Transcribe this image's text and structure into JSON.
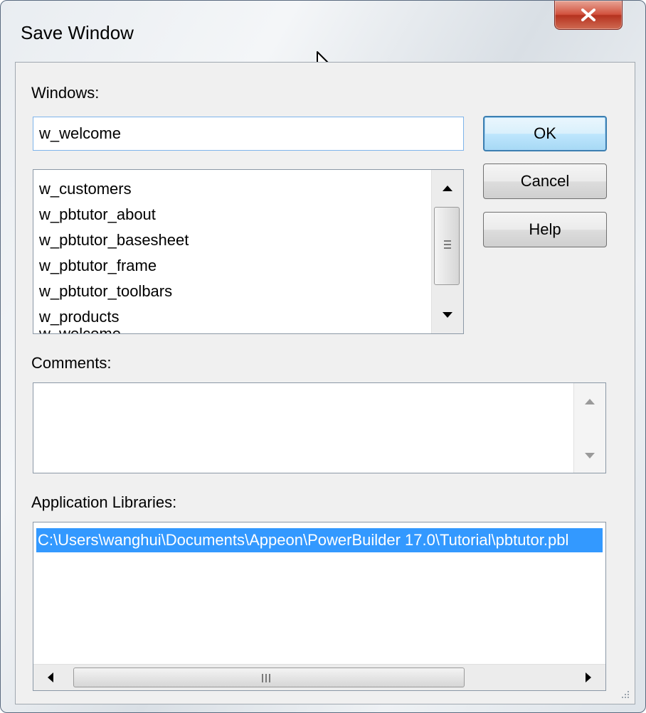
{
  "dialog": {
    "title": "Save Window"
  },
  "windows_section": {
    "label": "Windows:",
    "name_value": "w_welcome",
    "items": [
      "w_customers",
      "w_pbtutor_about",
      "w_pbtutor_basesheet",
      "w_pbtutor_frame",
      "w_pbtutor_toolbars",
      "w_products",
      "w_welcome"
    ]
  },
  "buttons": {
    "ok": "OK",
    "cancel": "Cancel",
    "help": "Help"
  },
  "comments_section": {
    "label": "Comments:",
    "value": ""
  },
  "libraries_section": {
    "label": "Application Libraries:",
    "items": [
      "C:\\Users\\wanghui\\Documents\\Appeon\\PowerBuilder 17.0\\Tutorial\\pbtutor.pbl"
    ]
  },
  "colors": {
    "selection": "#3399ff",
    "default_button_border": "#3c7fb1",
    "close_button": "#c8412c"
  },
  "icons": {
    "close": "close-x-icon",
    "cursor": "mouse-pointer-icon",
    "scroll_up": "scroll-up-arrow-icon",
    "scroll_down": "scroll-down-arrow-icon",
    "scroll_left": "scroll-left-arrow-icon",
    "scroll_right": "scroll-right-arrow-icon",
    "resize": "resize-grip-icon"
  }
}
